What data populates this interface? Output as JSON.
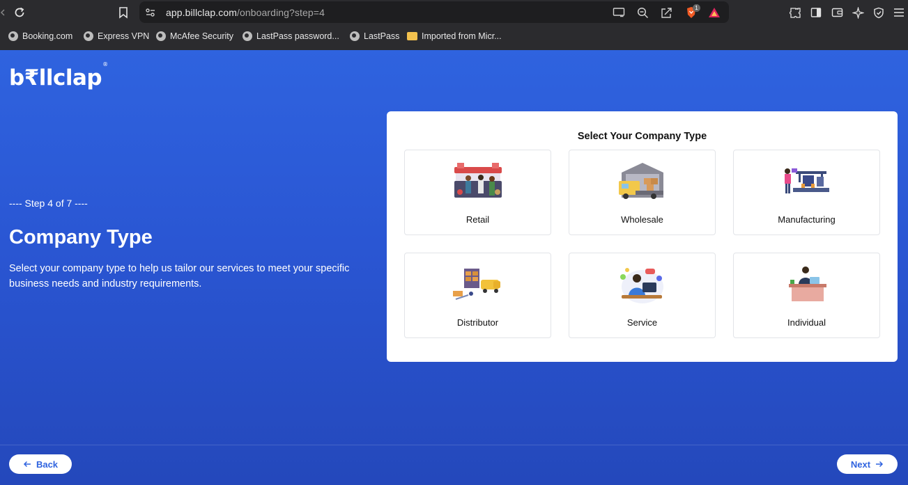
{
  "browser": {
    "url_host": "app.billclap.com",
    "url_path": "/onboarding?step=4",
    "shield_badge": "1",
    "bookmarks": [
      {
        "label": "Booking.com",
        "icon": "globe-icon"
      },
      {
        "label": "Express VPN",
        "icon": "globe-icon"
      },
      {
        "label": "McAfee Security",
        "icon": "globe-icon"
      },
      {
        "label": "LastPass password...",
        "icon": "globe-icon"
      },
      {
        "label": "LastPass",
        "icon": "globe-icon"
      },
      {
        "label": "Imported from Micr...",
        "icon": "folder-icon"
      }
    ]
  },
  "app": {
    "logo": "b₹llclap",
    "logo_mark": "®",
    "step_text": "---- Step 4 of 7 ----",
    "title": "Company Type",
    "description": "Select your company type to help us tailor our services to meet your specific business needs and industry requirements.",
    "card_title": "Select Your Company Type",
    "options": [
      {
        "label": "Retail",
        "icon": "retail-store-illustration"
      },
      {
        "label": "Wholesale",
        "icon": "wholesale-truck-illustration"
      },
      {
        "label": "Manufacturing",
        "icon": "manufacturing-illustration"
      },
      {
        "label": "Distributor",
        "icon": "distributor-illustration"
      },
      {
        "label": "Service",
        "icon": "service-illustration"
      },
      {
        "label": "Individual",
        "icon": "individual-illustration"
      }
    ],
    "back_label": "Back",
    "next_label": "Next"
  },
  "colors": {
    "brand_blue": "#2f63df",
    "card_bg": "#ffffff",
    "chrome_bg": "#2b2b2e"
  }
}
